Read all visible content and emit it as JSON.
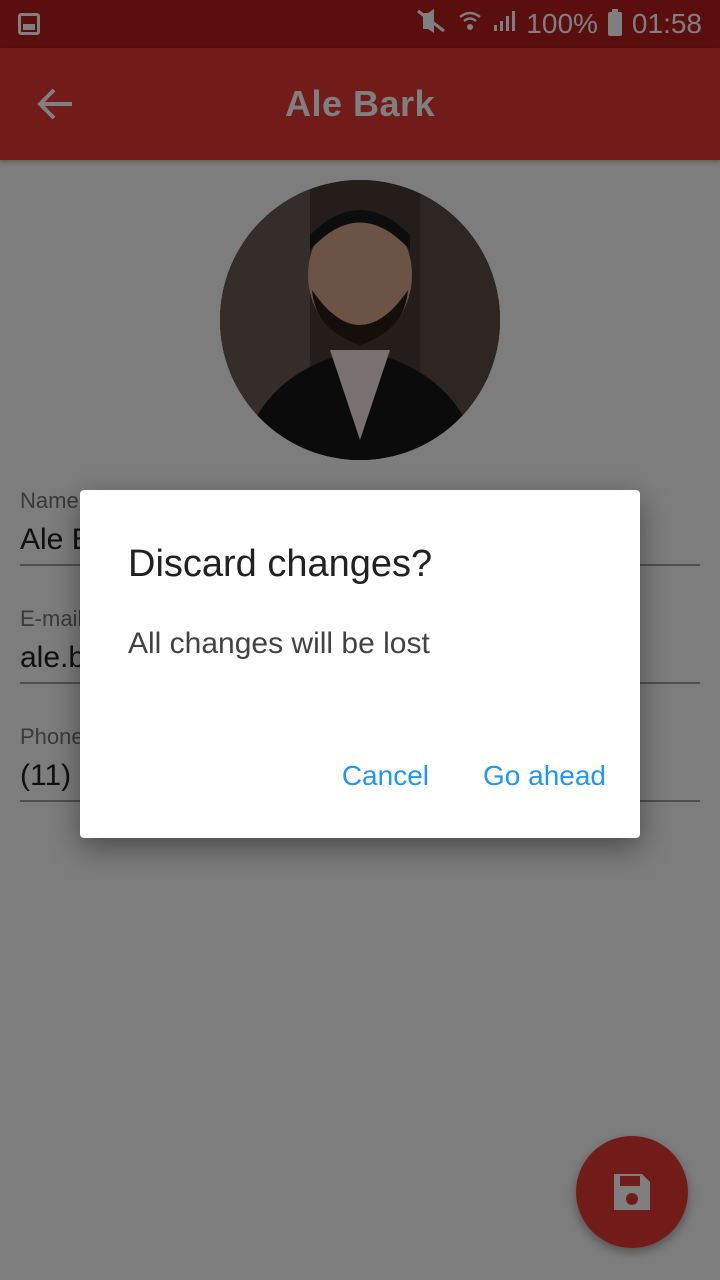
{
  "status_bar": {
    "battery": "100%",
    "time": "01:58",
    "icons": [
      "gallery-icon",
      "mute-icon",
      "wifi-icon",
      "signal-icon",
      "battery-icon"
    ]
  },
  "app_bar": {
    "title": "Ale Bark",
    "back_icon": "arrow-back-icon"
  },
  "form": {
    "name": {
      "label": "Name",
      "value": "Ale Bark"
    },
    "email": {
      "label": "E-mail",
      "value": "ale.bark"
    },
    "phone": {
      "label": "Phone",
      "value": "(11)"
    }
  },
  "fab": {
    "icon": "save-icon"
  },
  "dialog": {
    "title": "Discard changes?",
    "message": "All changes will be lost",
    "cancel_label": "Cancel",
    "confirm_label": "Go ahead"
  },
  "colors": {
    "primary": "#e53935",
    "primary_dark": "#b71c1c",
    "accent": "#2196f3"
  }
}
